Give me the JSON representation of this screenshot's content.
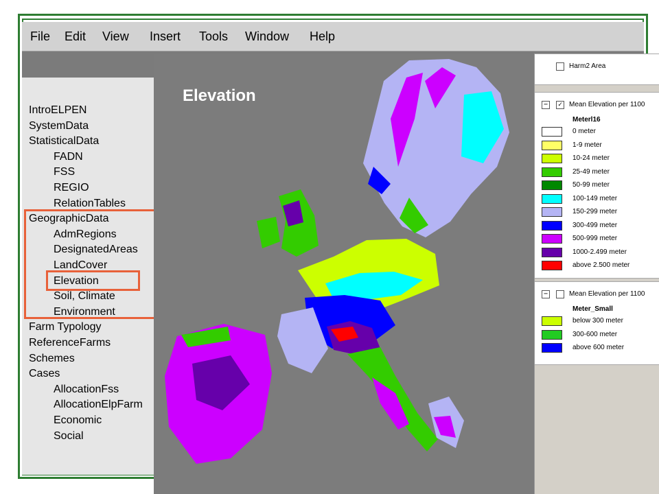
{
  "menu": [
    {
      "label": "File"
    },
    {
      "label": "Edit"
    },
    {
      "label": "View"
    },
    {
      "label": "Insert"
    },
    {
      "label": "Tools"
    },
    {
      "label": "Window"
    },
    {
      "label": "Help"
    }
  ],
  "tree": [
    {
      "label": "IntroELPEN",
      "indent": 0
    },
    {
      "label": "SystemData",
      "indent": 0
    },
    {
      "label": "StatisticalData",
      "indent": 0
    },
    {
      "label": "FADN",
      "indent": 1
    },
    {
      "label": "FSS",
      "indent": 1
    },
    {
      "label": "REGIO",
      "indent": 1
    },
    {
      "label": "RelationTables",
      "indent": 1
    },
    {
      "label": "GeographicData",
      "indent": 0
    },
    {
      "label": "AdmRegions",
      "indent": 1
    },
    {
      "label": "DesignatedAreas",
      "indent": 1
    },
    {
      "label": "LandCover",
      "indent": 1
    },
    {
      "label": "Elevation",
      "indent": 1,
      "selected": true
    },
    {
      "label": "Soil, Climate",
      "indent": 1
    },
    {
      "label": "Environment",
      "indent": 1
    },
    {
      "label": "Farm Typology",
      "indent": 0
    },
    {
      "label": "ReferenceFarms",
      "indent": 0
    },
    {
      "label": "Schemes",
      "indent": 0
    },
    {
      "label": "Cases",
      "indent": 0
    },
    {
      "label": "AllocationFss",
      "indent": 1
    },
    {
      "label": "AllocationElpFarm",
      "indent": 1
    },
    {
      "label": "Economic",
      "indent": 1
    },
    {
      "label": "Social",
      "indent": 1
    }
  ],
  "map": {
    "title": "Elevation"
  },
  "legend": {
    "layer1": {
      "name": "Harm2 Area",
      "checked": false
    },
    "layer2": {
      "name": "Mean Elevation per 1100",
      "checked": true,
      "sublayer": "Meterl16",
      "classes": [
        {
          "label": "0 meter",
          "color": "#ffffff"
        },
        {
          "label": "1-9 meter",
          "color": "#ffff66"
        },
        {
          "label": "10-24 meter",
          "color": "#ccff00"
        },
        {
          "label": "25-49 meter",
          "color": "#33cc00"
        },
        {
          "label": "50-99 meter",
          "color": "#008800"
        },
        {
          "label": "100-149 meter",
          "color": "#00ffff"
        },
        {
          "label": "150-299 meter",
          "color": "#b4b4f4"
        },
        {
          "label": "300-499 meter",
          "color": "#0000ff"
        },
        {
          "label": "500-999 meter",
          "color": "#cc00ff"
        },
        {
          "label": "1000-2.499 meter",
          "color": "#6600aa"
        },
        {
          "label": "above 2.500 meter",
          "color": "#ff0000"
        }
      ]
    },
    "layer3": {
      "name": "Mean Elevation per 1100",
      "checked": false,
      "sublayer": "Meter_Small",
      "classes": [
        {
          "label": "below 300 meter",
          "color": "#ccff00"
        },
        {
          "label": "300-600 meter",
          "color": "#22cc22"
        },
        {
          "label": "above 600 meter",
          "color": "#0000ff"
        }
      ]
    }
  }
}
